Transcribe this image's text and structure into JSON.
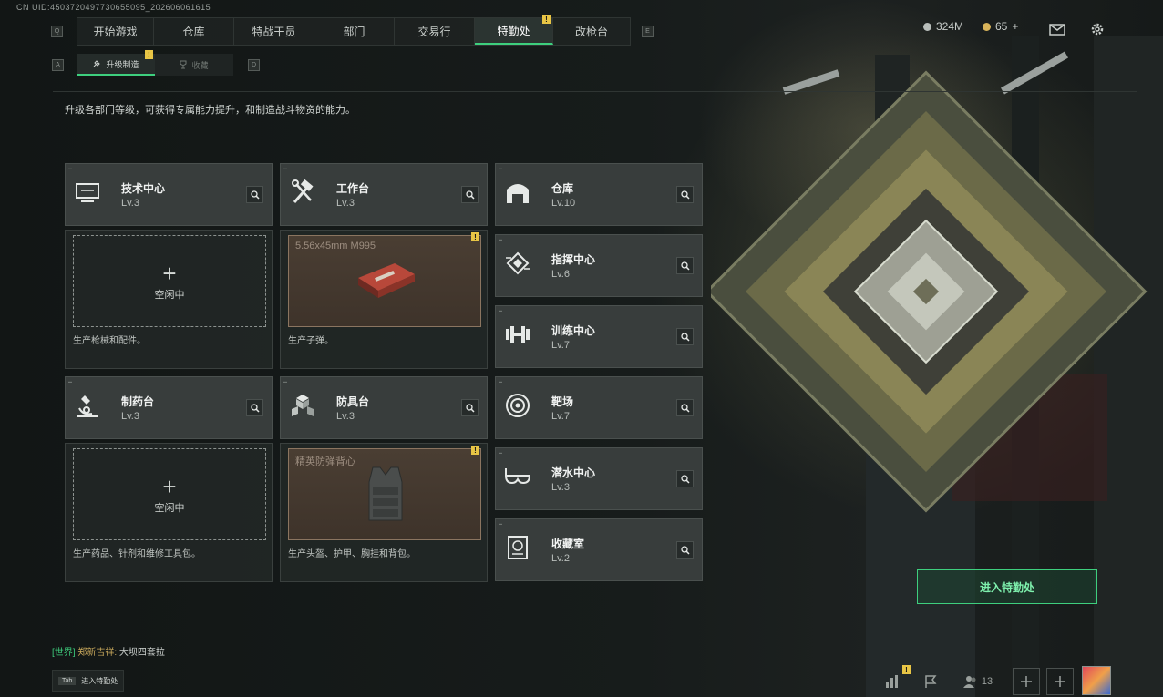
{
  "uid": "CN UID:4503720497730655095_202606061615",
  "nav": {
    "left_key": "Q",
    "right_key": "E",
    "tabs": [
      {
        "label": "开始游戏"
      },
      {
        "label": "仓库"
      },
      {
        "label": "特战干员"
      },
      {
        "label": "部门"
      },
      {
        "label": "交易行"
      },
      {
        "label": "特勤处",
        "active": true,
        "badge": "!"
      },
      {
        "label": "改枪台"
      }
    ]
  },
  "subnav": {
    "left_key": "A",
    "right_key": "D",
    "tabs": [
      {
        "label": "升级制造",
        "active": true,
        "badge": "!"
      },
      {
        "label": "收藏"
      }
    ]
  },
  "currency": {
    "silver": "324M",
    "gold": "65",
    "gold_plus": "+"
  },
  "description": "升级各部门等级，可获得专属能力提升，和制造战斗物资的能力。",
  "stations": {
    "tech": {
      "name": "技术中心",
      "lv": "Lv.3",
      "icon": "monitor-icon",
      "caption": "生产枪械和配件。",
      "idle": "空闲中"
    },
    "workbench": {
      "name": "工作台",
      "lv": "Lv.3",
      "icon": "hammer-wrench-icon",
      "caption": "生产子弹。",
      "product": "5.56x45mm M995",
      "badge": "!"
    },
    "pharmacy": {
      "name": "制药台",
      "lv": "Lv.3",
      "icon": "microscope-icon",
      "caption": "生产药品、针剂和维修工具包。",
      "idle": "空闲中"
    },
    "armor": {
      "name": "防具台",
      "lv": "Lv.3",
      "icon": "blocks-icon",
      "caption": "生产头盔、护甲、胸挂和背包。",
      "product": "精英防弹背心",
      "badge": "!"
    }
  },
  "departments": [
    {
      "name": "仓库",
      "lv": "Lv.10",
      "icon": "warehouse-icon"
    },
    {
      "name": "指挥中心",
      "lv": "Lv.6",
      "icon": "chip-icon"
    },
    {
      "name": "训练中心",
      "lv": "Lv.7",
      "icon": "dumbbell-icon"
    },
    {
      "name": "靶场",
      "lv": "Lv.7",
      "icon": "target-icon"
    },
    {
      "name": "潜水中心",
      "lv": "Lv.3",
      "icon": "diving-mask-icon"
    },
    {
      "name": "收藏室",
      "lv": "Lv.2",
      "icon": "collection-icon"
    }
  ],
  "enter_button": "进入特勤处",
  "chat": {
    "channel": "[世界]",
    "user": "郑新吉祥:",
    "message": "大坝四套拉"
  },
  "tab_hint": {
    "key": "Tab",
    "label": "进入特勤处"
  },
  "bottom": {
    "friends_count": "13",
    "stats_badge": "!"
  }
}
